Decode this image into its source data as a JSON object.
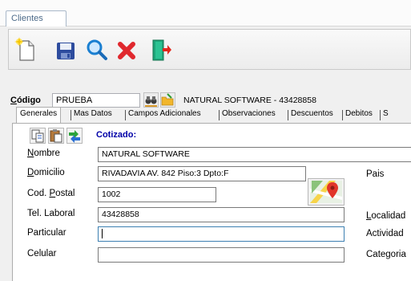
{
  "window": {
    "tab_label": "Clientes"
  },
  "toolbar": {
    "buttons": [
      {
        "name": "new-icon"
      },
      {
        "name": "save-icon"
      },
      {
        "name": "search-icon"
      },
      {
        "name": "delete-icon"
      },
      {
        "name": "exit-icon"
      }
    ]
  },
  "header": {
    "code_label_u": "C",
    "code_label_rest": "ódigo",
    "code_value": "PRUEBA",
    "client_description": "NATURAL SOFTWARE - 43428858"
  },
  "tabs": [
    {
      "label": "Generales",
      "active": true
    },
    {
      "label": "Mas Datos"
    },
    {
      "label": "Campos Adicionales"
    },
    {
      "label": "Observaciones"
    },
    {
      "label": "Descuentos"
    },
    {
      "label": "Debitos"
    },
    {
      "label": "S"
    }
  ],
  "panel": {
    "status": "Cotizado:",
    "fields": {
      "nombre": {
        "label_u": "N",
        "label_rest": "ombre",
        "value": "NATURAL SOFTWARE"
      },
      "domicilio": {
        "label_u": "D",
        "label_rest": "omicilio",
        "value": "RIVADAVIA AV. 842 Piso:3 Dpto:F"
      },
      "cod_postal": {
        "label_pre": "Cod. ",
        "label_u": "P",
        "label_rest": "ostal",
        "value": "1002"
      },
      "tel_laboral": {
        "label": "Tel. Laboral",
        "value": "43428858"
      },
      "particular": {
        "label": "Particular",
        "value": ""
      },
      "celular": {
        "label": "Celular",
        "value": ""
      }
    },
    "right_labels": {
      "pais": "Pais",
      "localidad_u": "L",
      "localidad_rest": "ocalidad",
      "actividad": "Actividad",
      "categoria": "Categoria"
    }
  },
  "colors": {
    "accent_blue": "#0000a8",
    "tab_text": "#4d6b8a"
  }
}
